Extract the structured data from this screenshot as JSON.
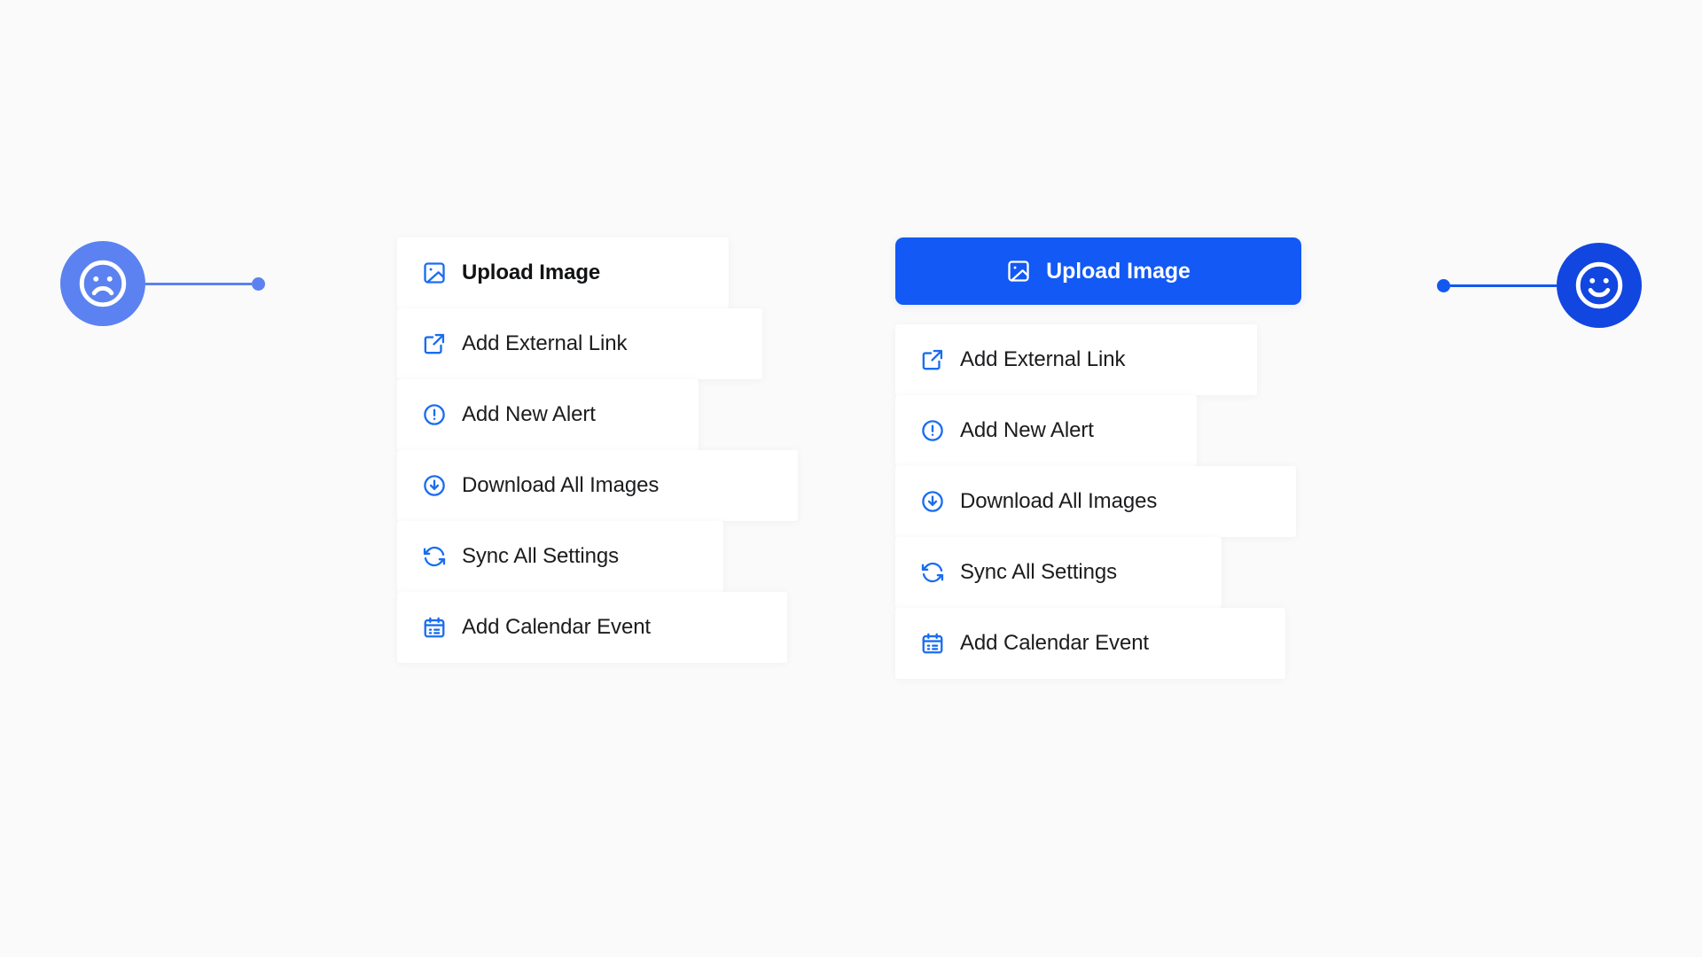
{
  "background_color": "#fafafa",
  "accent_color": "#1259f5",
  "muted_accent_color": "#5b82f0",
  "markers": {
    "sad": {
      "icon": "frowning-face-icon",
      "label": "Negative rating marker",
      "circle_color": "#5b82f0",
      "connector_color": "#5b82f0"
    },
    "happy": {
      "icon": "smiling-face-icon",
      "label": "Positive rating marker",
      "circle_color": "#1246e0",
      "connector_color": "#1258f0"
    }
  },
  "menu_left": {
    "name": "before-menu",
    "items": [
      {
        "icon": "image-icon",
        "label": "Upload Image",
        "primary": true
      },
      {
        "icon": "external-link-icon",
        "label": "Add External Link",
        "primary": false
      },
      {
        "icon": "alert-circle-icon",
        "label": "Add New Alert",
        "primary": false
      },
      {
        "icon": "download-circle-icon",
        "label": "Download All Images",
        "primary": false
      },
      {
        "icon": "sync-icon",
        "label": "Sync All Settings",
        "primary": false
      },
      {
        "icon": "calendar-icon",
        "label": "Add Calendar Event",
        "primary": false
      }
    ]
  },
  "menu_right": {
    "name": "after-menu",
    "primary_button": {
      "icon": "image-icon",
      "label": "Upload Image",
      "background_color": "#1259f5",
      "text_color": "#ffffff"
    },
    "items": [
      {
        "icon": "external-link-icon",
        "label": "Add External Link"
      },
      {
        "icon": "alert-circle-icon",
        "label": "Add New Alert"
      },
      {
        "icon": "download-circle-icon",
        "label": "Download All Images"
      },
      {
        "icon": "sync-icon",
        "label": "Sync All Settings"
      },
      {
        "icon": "calendar-icon",
        "label": "Add Calendar Event"
      }
    ]
  }
}
